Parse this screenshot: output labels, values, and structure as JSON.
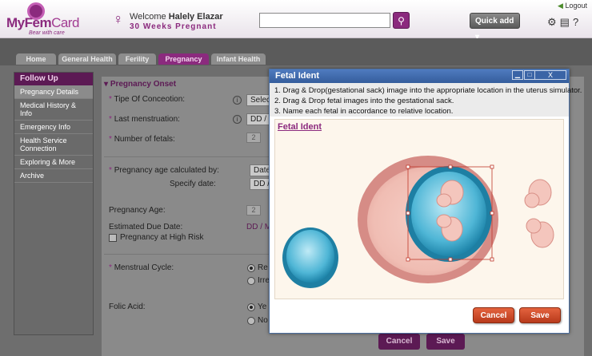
{
  "header": {
    "logo_name": "MyFemCard",
    "logo_name_a": "MyFem",
    "logo_name_b": "Card",
    "logo_tagline": "Bear with care",
    "welcome_prefix": "Welcome",
    "user_name": "Halely Elazar",
    "pregnancy_status": "30 Weeks Pregnant",
    "search_placeholder": "",
    "quick_add_label": "Quick add",
    "logout_label": "Logout",
    "icons": [
      "gear-icon",
      "document-icon",
      "help-icon"
    ]
  },
  "tabs": [
    {
      "label": "Home",
      "active": false
    },
    {
      "label": "General Health",
      "active": false
    },
    {
      "label": "Ferility",
      "active": false
    },
    {
      "label": "Pregnancy",
      "active": true
    },
    {
      "label": "Infant Health",
      "active": false
    }
  ],
  "sidebar": {
    "heading": "Follow Up",
    "items": [
      {
        "label": "Pregnancy Details",
        "active": true
      },
      {
        "label": "Medical History & Info",
        "active": false
      },
      {
        "label": "Emergency Info",
        "active": false
      },
      {
        "label": "Health Service Connection",
        "active": false
      },
      {
        "label": "Exploring & More",
        "active": false
      },
      {
        "label": "Archive",
        "active": false
      }
    ]
  },
  "form": {
    "section_title": "Pregnancy Onset",
    "conception_label": "Tipe Of Conceotion:",
    "conception_value": "Selec",
    "last_menstruation_label": "Last menstruation:",
    "last_menstruation_value": "DD /",
    "num_fetals_label": "Number of fetals:",
    "num_fetals_value": "2",
    "preg_age_calc_label": "Pregnancy age calculated by:",
    "preg_age_calc_value": "Date",
    "specify_date_label": "Specify date:",
    "specify_date_value": "DD /",
    "preg_age_label": "Pregnancy Age:",
    "preg_age_value": "2",
    "due_date_label": "Estimated Due Date:",
    "due_date_value": "DD / M",
    "high_risk_label": "Pregnancy at High Risk",
    "menstrual_cycle_label": "Menstrual Cycle:",
    "menstrual_opt1": "Re",
    "menstrual_opt2": "Irre",
    "folic_acid_label": "Folic Acid:",
    "folic_opt1": "Ye",
    "folic_opt2": "No",
    "cancel_label": "Cancel",
    "save_label": "Save"
  },
  "modal": {
    "title": "Fetal Ident",
    "controls": [
      "minimize-icon",
      "maximize-icon",
      "close-icon"
    ],
    "close_glyph": "X",
    "instructions": [
      "1. Drag & Drop(gestational sack) image into the appropriate location in the uterus simulator.",
      "2. Drag & Drop fetal images into the gestational sack.",
      "3. Name each fetal in accordance to relative location."
    ],
    "link_label": "Fetal Ident",
    "cancel_label": "Cancel",
    "save_label": "Save"
  },
  "colors": {
    "brand": "#8b2a7e",
    "modal_titlebar": "#4f7bbf",
    "action_button": "#d04d2b",
    "uterus": "#d99590",
    "sack": "#3ba7c9"
  }
}
